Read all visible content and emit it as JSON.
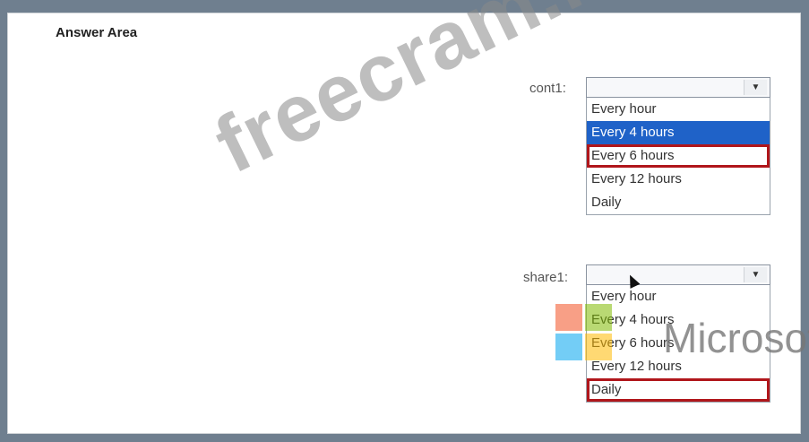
{
  "answer_area": {
    "title": "Answer Area"
  },
  "dropdowns": [
    {
      "label": "cont1:",
      "selected_value": "",
      "options": [
        "Every hour",
        "Every 4 hours",
        "Every 6 hours",
        "Every 12 hours",
        "Daily"
      ],
      "highlighted_option": "Every 4 hours",
      "boxed_option": "Every 6 hours"
    },
    {
      "label": "share1:",
      "selected_value": "",
      "options": [
        "Every hour",
        "Every 4 hours",
        "Every 6 hours",
        "Every 12 hours",
        "Daily"
      ],
      "highlighted_option": "",
      "boxed_option": "Daily"
    }
  ],
  "watermarks": {
    "site": "freecram.net",
    "brand": "Microsoft"
  },
  "icons": {
    "dropdown_arrow": "chevron-down-icon",
    "cursor": "mouse-pointer-icon",
    "logo": "microsoft-logo-icon"
  },
  "colors": {
    "selection_blue": "#1f62c8",
    "answer_box_red": "#b0161b",
    "frame_background": "#6f7f8f"
  }
}
